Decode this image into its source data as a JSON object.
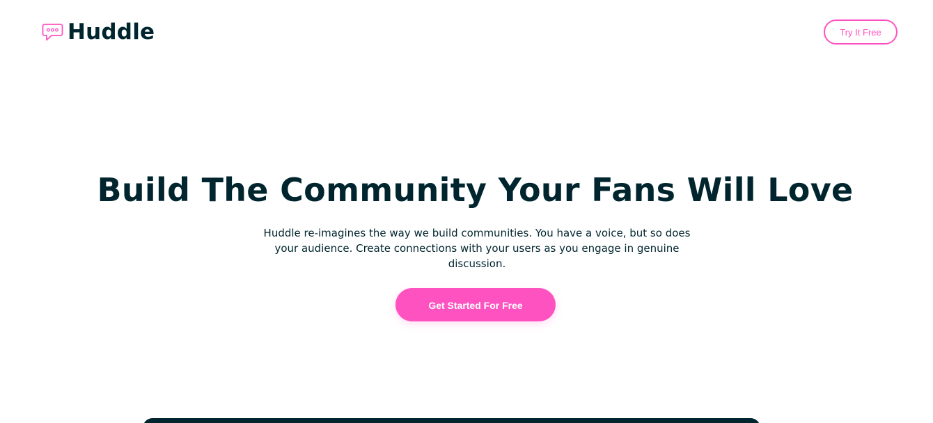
{
  "header": {
    "brand_name": "Huddle",
    "brand_icon": "chat-bubble-icon",
    "cta_label": "Try It Free"
  },
  "hero": {
    "title": "Build The Community Your Fans Will Love",
    "description": "Huddle re-imagines the way we build communities. You have a voice, but so does your audience. Create connections with your users as you engage in genuine discussion.",
    "cta_label": "Get Started For Free"
  },
  "colors": {
    "accent": "#ff52c1",
    "text_dark": "#00252e",
    "background": "#ffffff"
  }
}
